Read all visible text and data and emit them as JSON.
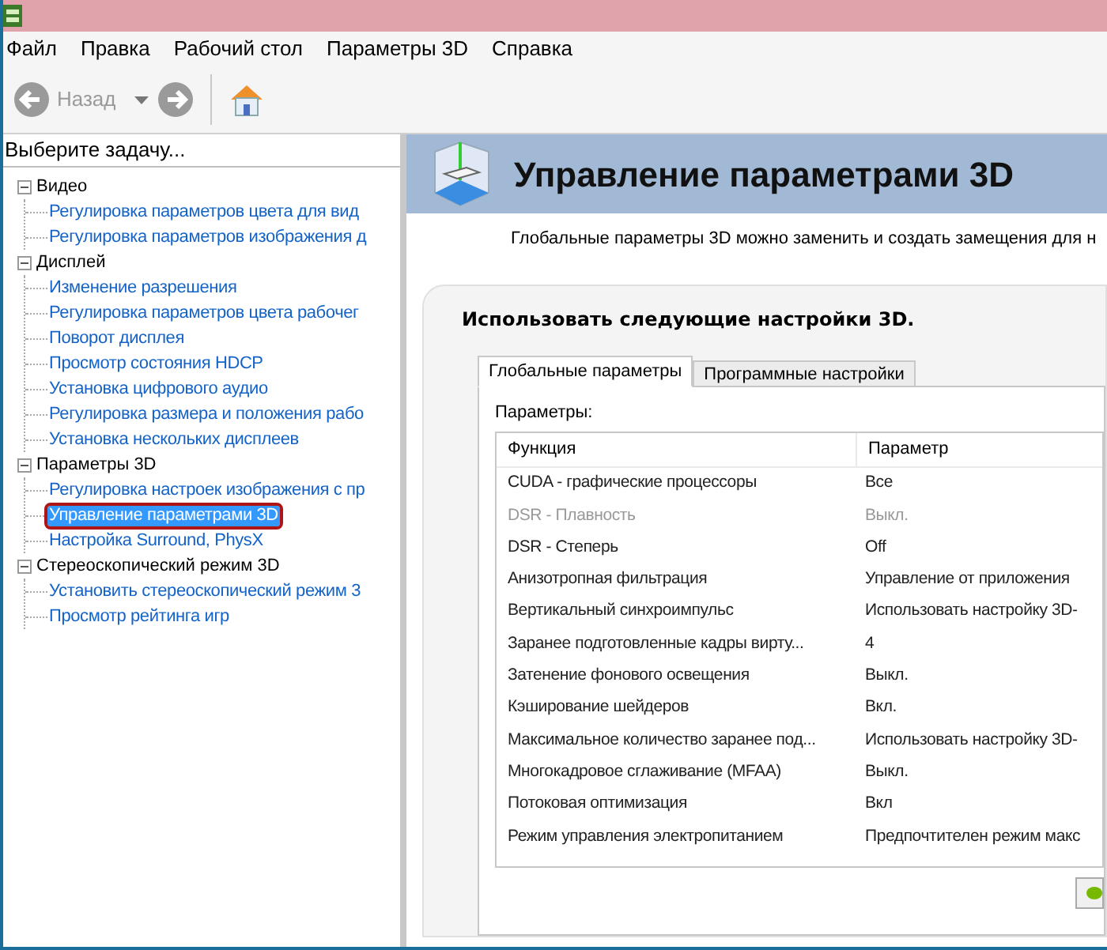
{
  "menu": [
    "Файл",
    "Правка",
    "Рабочий стол",
    "Параметры 3D",
    "Справка"
  ],
  "toolbar": {
    "back_label": "Назад"
  },
  "task_panel": {
    "title": "Выберите задачу...",
    "tree": [
      {
        "label": "Видео",
        "expanded": true,
        "children": [
          {
            "label": "Регулировка параметров цвета для вид",
            "selected": false
          },
          {
            "label": "Регулировка параметров изображения д",
            "selected": false
          }
        ]
      },
      {
        "label": "Дисплей",
        "expanded": true,
        "children": [
          {
            "label": "Изменение разрешения",
            "selected": false
          },
          {
            "label": "Регулировка параметров цвета рабочег",
            "selected": false
          },
          {
            "label": "Поворот дисплея",
            "selected": false
          },
          {
            "label": "Просмотр состояния HDCP",
            "selected": false
          },
          {
            "label": "Установка цифрового аудио",
            "selected": false
          },
          {
            "label": "Регулировка размера и положения рабо",
            "selected": false
          },
          {
            "label": "Установка нескольких дисплеев",
            "selected": false
          }
        ]
      },
      {
        "label": "Параметры 3D",
        "expanded": true,
        "children": [
          {
            "label": "Регулировка настроек изображения с пр",
            "selected": false
          },
          {
            "label": "Управление параметрами 3D",
            "selected": true
          },
          {
            "label": "Настройка Surround, PhysX",
            "selected": false
          }
        ]
      },
      {
        "label": "Стереоскопический режим 3D",
        "expanded": true,
        "children": [
          {
            "label": "Установить стереоскопический режим 3",
            "selected": false
          },
          {
            "label": "Просмотр рейтинга игр",
            "selected": false
          }
        ]
      }
    ]
  },
  "page": {
    "title": "Управление параметрами 3D",
    "description": "Глобальные параметры 3D можно заменить и создать замещения для н",
    "section_title": "Использовать следующие настройки 3D.",
    "tabs": [
      {
        "label": "Глобальные параметры",
        "selected": true
      },
      {
        "label": "Программные настройки",
        "selected": false
      }
    ],
    "params_label": "Параметры:",
    "table": {
      "columns": [
        "Функция",
        "Параметр"
      ],
      "rows": [
        {
          "function": "CUDA - графические процессоры",
          "value": "Все",
          "disabled": false
        },
        {
          "function": "DSR - Плавность",
          "value": "Выкл.",
          "disabled": true
        },
        {
          "function": "DSR - Степерь",
          "value": "Off",
          "disabled": false
        },
        {
          "function": "Анизотропная фильтрация",
          "value": "Управление от приложения",
          "disabled": false
        },
        {
          "function": "Вертикальный синхроимпульс",
          "value": "Использовать настройку 3D-",
          "disabled": false
        },
        {
          "function": "Заранее подготовленные кадры вирту...",
          "value": "4",
          "disabled": false
        },
        {
          "function": "Затенение фонового освещения",
          "value": "Выкл.",
          "disabled": false
        },
        {
          "function": "Кэширование шейдеров",
          "value": "Вкл.",
          "disabled": false
        },
        {
          "function": "Максимальное количество заранее под...",
          "value": "Использовать настройку 3D-",
          "disabled": false
        },
        {
          "function": "Многокадровое сглаживание (MFAA)",
          "value": "Выкл.",
          "disabled": false
        },
        {
          "function": "Потоковая оптимизация",
          "value": "Вкл",
          "disabled": false
        },
        {
          "function": "Режим управления электропитанием",
          "value": "Предпочтителен режим макс",
          "disabled": false
        }
      ]
    }
  }
}
